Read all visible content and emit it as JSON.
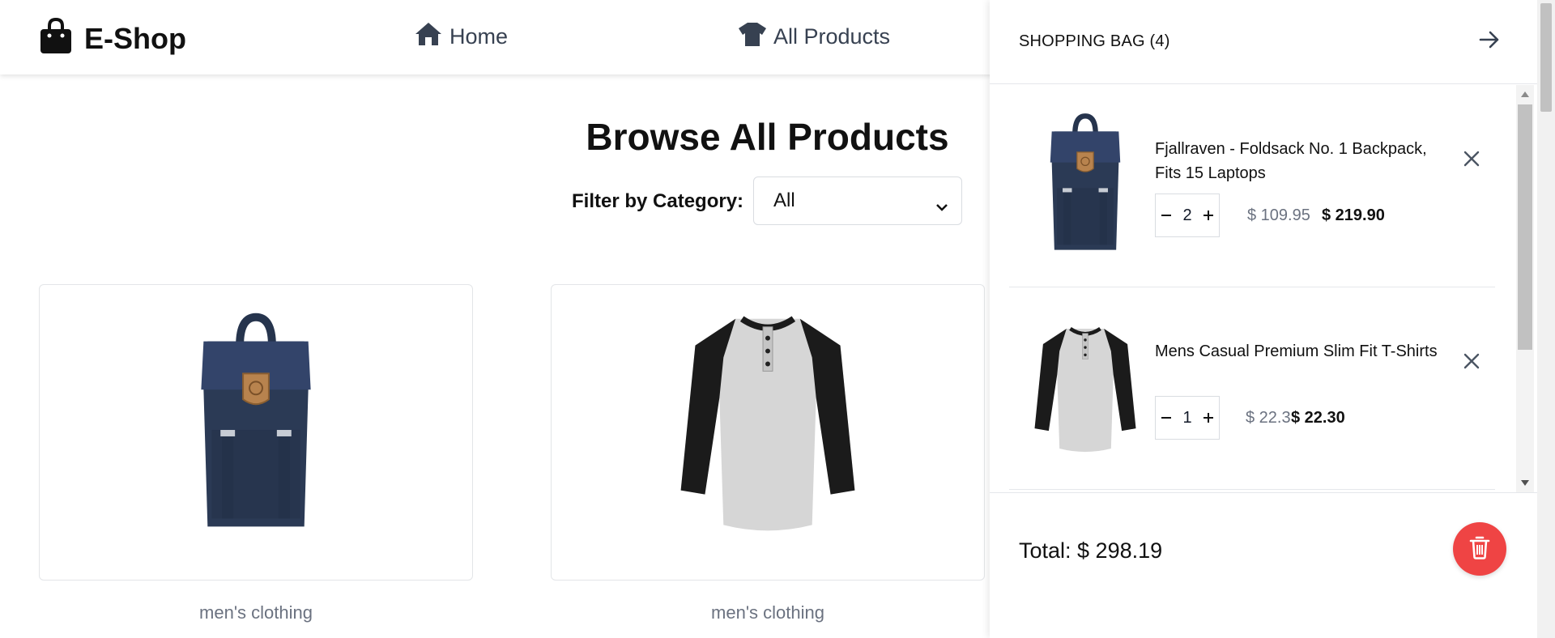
{
  "header": {
    "brand": "E-Shop",
    "nav": [
      {
        "label": "Home",
        "icon": "home-icon"
      },
      {
        "label": "All Products",
        "icon": "tshirt-icon"
      }
    ]
  },
  "main": {
    "title": "Browse All Products",
    "filter": {
      "label": "Filter by Category:",
      "selected": "All"
    },
    "products": [
      {
        "category": "men's clothing",
        "image": "backpack"
      },
      {
        "category": "men's clothing",
        "image": "raglan-shirt"
      }
    ]
  },
  "cart": {
    "title": "SHOPPING BAG (4)",
    "items": [
      {
        "name": "Fjallraven - Foldsack No. 1 Backpack, Fits 15 Laptops",
        "qty": "2",
        "unit_price": "$ 109.95",
        "line_total": "$ 219.90",
        "image": "backpack"
      },
      {
        "name": "Mens Casual Premium Slim Fit T-Shirts",
        "qty": "1",
        "unit_price": "$ 22.3",
        "line_total": "$ 22.30",
        "image": "raglan-shirt"
      }
    ],
    "total": "Total: $ 298.19",
    "clear_icon": "trash-icon",
    "close_icon": "arrow-right-icon"
  },
  "colors": {
    "accent_danger": "#ef4444",
    "backpack_navy": "#2b3a55",
    "text_muted": "#6b7280"
  }
}
